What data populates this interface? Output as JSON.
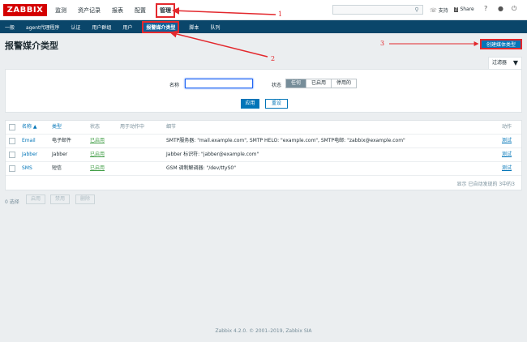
{
  "header": {
    "logo": "ZABBIX",
    "menu": [
      "监测",
      "资产记录",
      "报表",
      "配置",
      "管理"
    ],
    "active_menu_index": 4,
    "support": "支持",
    "share": "Share",
    "help": "?",
    "user_icon": "user-icon",
    "logout_icon": "power-icon"
  },
  "submenu": {
    "items": [
      "一般",
      "agent代理程序",
      "认证",
      "用户群组",
      "用户",
      "报警媒介类型",
      "脚本",
      "队列"
    ],
    "active_index": 5
  },
  "page": {
    "title": "报警媒介类型",
    "create_button": "创建媒体类型"
  },
  "annotations": {
    "a1": "1",
    "a2": "2",
    "a3": "3"
  },
  "filter": {
    "tab_label": "过滤器",
    "name_label": "名称",
    "name_value": "",
    "status_label": "状态",
    "status_options": [
      "任何",
      "已启用",
      "停用的"
    ],
    "status_selected": 0,
    "apply": "应用",
    "reset": "重设"
  },
  "table": {
    "columns": [
      "名称 ▲",
      "类型",
      "状态",
      "用于动作中",
      "细节",
      "动作"
    ],
    "rows": [
      {
        "name": "Email",
        "type": "电子邮件",
        "status": "已启用",
        "used": "",
        "details": "SMTP服务器: \"mail.example.com\", SMTP HELO: \"example.com\", SMTP电邮: \"zabbix@example.com\"",
        "action": "测试"
      },
      {
        "name": "Jabber",
        "type": "Jabber",
        "status": "已启用",
        "used": "",
        "details": "Jabber 标识符: \"jabber@example.com\"",
        "action": "测试"
      },
      {
        "name": "SMS",
        "type": "短信",
        "status": "已启用",
        "used": "",
        "details": "GSM 调制解调器: \"/dev/ttyS0\"",
        "action": "测试"
      }
    ],
    "footer": "显示 已自动发现的 3中的3"
  },
  "bulk": {
    "selected": "0 选择",
    "buttons": [
      "启用",
      "禁用",
      "删除"
    ]
  },
  "copyright": "Zabbix 4.2.0. © 2001–2019, Zabbix SIA",
  "colors": {
    "brand_red": "#d40000",
    "nav_blue": "#0a466a",
    "primary": "#0275b8",
    "annotation_red": "#e3282d",
    "enabled_green": "#429e47"
  }
}
